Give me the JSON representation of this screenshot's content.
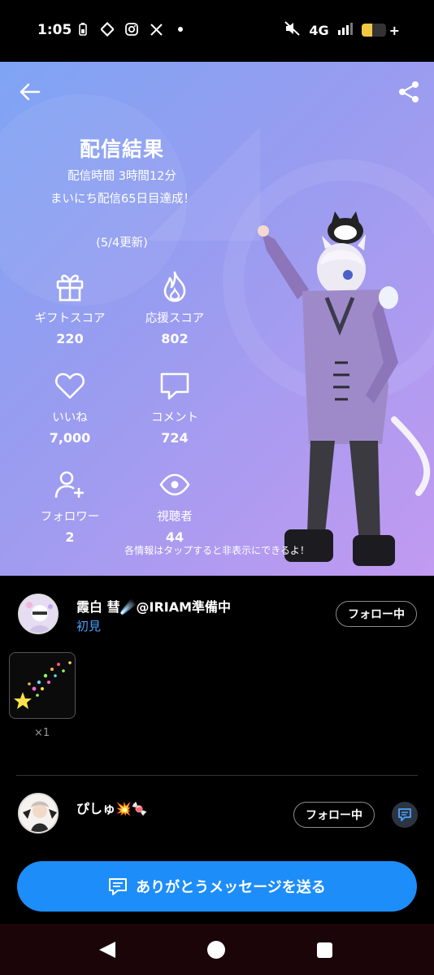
{
  "status_bar": {
    "time": "1:05",
    "network": "4G",
    "battery_level": 0.45,
    "battery_color": "#f2c744"
  },
  "header": {
    "back_icon": "arrow-left-icon",
    "share_icon": "share-icon"
  },
  "summary": {
    "title": "配信結果",
    "duration": "配信時間 3時間12分",
    "streak": "まいにち配信65日目達成！",
    "updated": "(5/4更新)"
  },
  "stats": [
    {
      "icon": "gift-icon",
      "label": "ギフトスコア",
      "value": "220"
    },
    {
      "icon": "flame-icon",
      "label": "応援スコア",
      "value": "802"
    },
    {
      "icon": "heart-icon",
      "label": "いいね",
      "value": "7,000"
    },
    {
      "icon": "comment-icon",
      "label": "コメント",
      "value": "724"
    },
    {
      "icon": "user-plus-icon",
      "label": "フォロワー",
      "value": "2"
    },
    {
      "icon": "eye-icon",
      "label": "視聴者",
      "value": "44"
    }
  ],
  "hint": "各情報はタップすると非表示にできるよ！",
  "supporters": [
    {
      "name": "霞白 彗☄️@IRIAM準備中",
      "tag": "初見",
      "follow_label": "フォロー中",
      "gift_count": "×1"
    },
    {
      "name": "ぴしゅ💥🍬",
      "follow_label": "フォロー中"
    }
  ],
  "cta": {
    "label": "ありがとうメッセージを送る"
  },
  "colors": {
    "accent": "#1d8dfa",
    "tag": "#4aa1ff"
  }
}
